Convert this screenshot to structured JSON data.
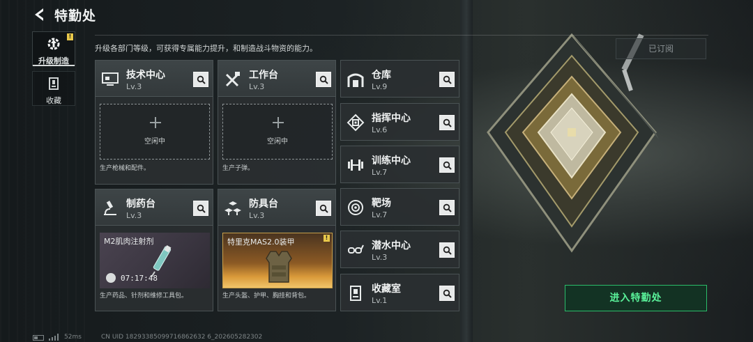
{
  "header": {
    "title": "特勤处"
  },
  "sidebar": {
    "items": [
      {
        "label": "升级制造",
        "active": true,
        "badge": "!"
      },
      {
        "label": "收藏",
        "active": false
      }
    ]
  },
  "subtitle": "升级各部门等级，可获得专属能力提升，和制造战斗物资的能力。",
  "subscribed_label": "已订阅",
  "enter_button": "进入特勤处",
  "production": [
    {
      "name": "技术中心",
      "level": "Lv.3",
      "icon": "monitor-icon",
      "slot": {
        "status": "空闲中"
      },
      "desc": "生产枪械和配件。"
    },
    {
      "name": "工作台",
      "level": "Lv.3",
      "icon": "tools-icon",
      "slot": {
        "status": "空闲中"
      },
      "desc": "生产子弹。"
    },
    {
      "name": "制药台",
      "level": "Lv.3",
      "icon": "microscope-icon",
      "item": {
        "title": "M2肌肉注射剂",
        "time": "07:17:48"
      },
      "desc": "生产药品、针剂和维修工具包。"
    },
    {
      "name": "防具台",
      "level": "Lv.3",
      "icon": "armor-blocks-icon",
      "item": {
        "title": "特里克MAS2.0装甲",
        "badge": "!"
      },
      "desc": "生产头盔、护甲、胸挂和背包。"
    }
  ],
  "facilities": [
    {
      "name": "仓库",
      "level": "Lv.9",
      "icon": "warehouse-icon"
    },
    {
      "name": "指挥中心",
      "level": "Lv.6",
      "icon": "command-chip-icon"
    },
    {
      "name": "训练中心",
      "level": "Lv.7",
      "icon": "dumbbell-icon"
    },
    {
      "name": "靶场",
      "level": "Lv.7",
      "icon": "target-icon"
    },
    {
      "name": "潜水中心",
      "level": "Lv.3",
      "icon": "diving-mask-icon"
    },
    {
      "name": "收藏室",
      "level": "Lv.1",
      "icon": "trophy-icon"
    }
  ],
  "footer": {
    "ping": "52ms",
    "uid": "CN UID 18293385099716862632 6_202605282302"
  },
  "colors": {
    "accent_green": "#2bbd6a",
    "badge_yellow": "#e8c84a"
  }
}
